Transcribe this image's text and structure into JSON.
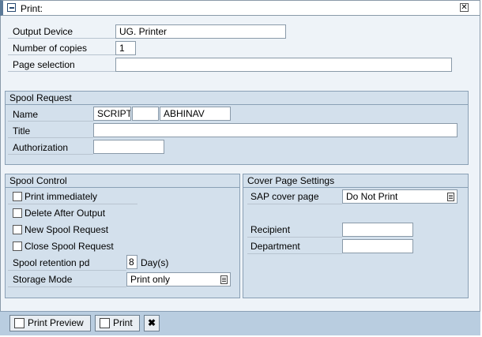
{
  "window": {
    "title": "Print:"
  },
  "output": {
    "device_label": "Output Device",
    "device_value": "UG. Printer",
    "copies_label": "Number of copies",
    "copies_value": "1",
    "page_label": "Page selection",
    "page_value": ""
  },
  "spool_request": {
    "group_title": "Spool Request",
    "name_label": "Name",
    "name_part1": "SCRIPT",
    "name_part2": "",
    "name_part3": "ABHINAV",
    "title_label": "Title",
    "title_value": "",
    "auth_label": "Authorization",
    "auth_value": ""
  },
  "spool_control": {
    "group_title": "Spool Control",
    "print_immediately": "Print immediately",
    "delete_after_output": "Delete After Output",
    "new_spool_request": "New Spool Request",
    "close_spool_request": "Close Spool Request",
    "retention_label": "Spool retention pd",
    "retention_value": "8",
    "retention_unit": "Day(s)",
    "storage_label": "Storage Mode",
    "storage_value": "Print only"
  },
  "cover_page": {
    "group_title": "Cover Page Settings",
    "sap_cover_label": "SAP cover page",
    "sap_cover_value": "Do Not Print",
    "recipient_label": "Recipient",
    "recipient_value": "",
    "department_label": "Department",
    "department_value": ""
  },
  "footer": {
    "print_preview": "Print Preview",
    "print": "Print"
  }
}
